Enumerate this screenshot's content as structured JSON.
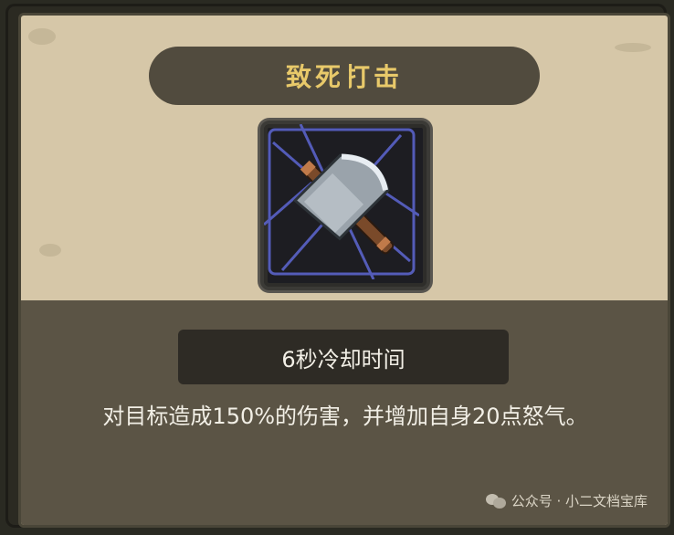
{
  "skill": {
    "title": "致死打击",
    "icon": "battle-axe-icon",
    "cooldown": "6秒冷却时间",
    "description": "对目标造成150%的伤害，并增加自身20点怒气。"
  },
  "watermark": {
    "text": "公众号 · 小二文档宝库",
    "icon": "wechat-icon"
  },
  "colors": {
    "title": "#e8c96a",
    "parchment": "#d6c7a8",
    "panel": "#5b5445",
    "text": "#f2efe6"
  }
}
